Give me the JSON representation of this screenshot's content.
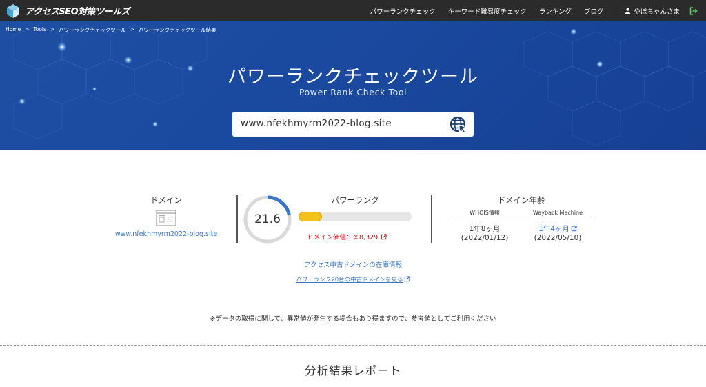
{
  "header": {
    "logo_text": "アクセスSEO対策ツールズ",
    "nav": [
      "パワーランクチェック",
      "キーワード難易度チェック",
      "ランキング",
      "ブログ"
    ],
    "user_name": "やぽちゃんさま"
  },
  "breadcrumb": [
    "Home",
    "Tools",
    "パワーランクチェックツール",
    "パワーランクチェックツール結果"
  ],
  "breadcrumb_separator": ">",
  "hero": {
    "title": "パワーランクチェックツール",
    "subtitle": "Power Rank Check Tool",
    "search_value": "www.nfekhmyrm2022-blog.site"
  },
  "domain_section": {
    "label": "ドメイン",
    "domain": "www.nfekhmyrm2022-blog.site"
  },
  "power_rank": {
    "label": "パワーランク",
    "value": "21.6",
    "gauge_fraction": 0.22,
    "bar_fraction": 0.21,
    "domain_value_text": "ドメイン価値：￥8,329"
  },
  "domain_age": {
    "label": "ドメイン年齢",
    "columns": [
      "WHOIS情報",
      "Wayback Machine"
    ],
    "whois_age": "1年8ヶ月",
    "whois_date": "(2022/01/12)",
    "wayback_age": "1年4ヶ月",
    "wayback_date": "(2022/05/10)"
  },
  "links": {
    "inventory": "アクセス中古ドメインの在庫情報",
    "powerrank20": "パワーランク20台の中古ドメインを見る"
  },
  "notice": "※データの取得に関して、異常値が発生する場合もあり得ますので、参考値としてご利用ください",
  "report_title": "分析結果レポート",
  "colors": {
    "topnav": "#2b2b2b",
    "hero": "#1f4fa3",
    "link": "#3a78c9",
    "bar": "#f3c11b",
    "gauge": "#3a78c9",
    "price": "#d0121b"
  },
  "icons": [
    "logo-cube-icon",
    "user-icon",
    "logout-icon",
    "globe-cursor-icon",
    "document-icon",
    "external-link-icon"
  ]
}
